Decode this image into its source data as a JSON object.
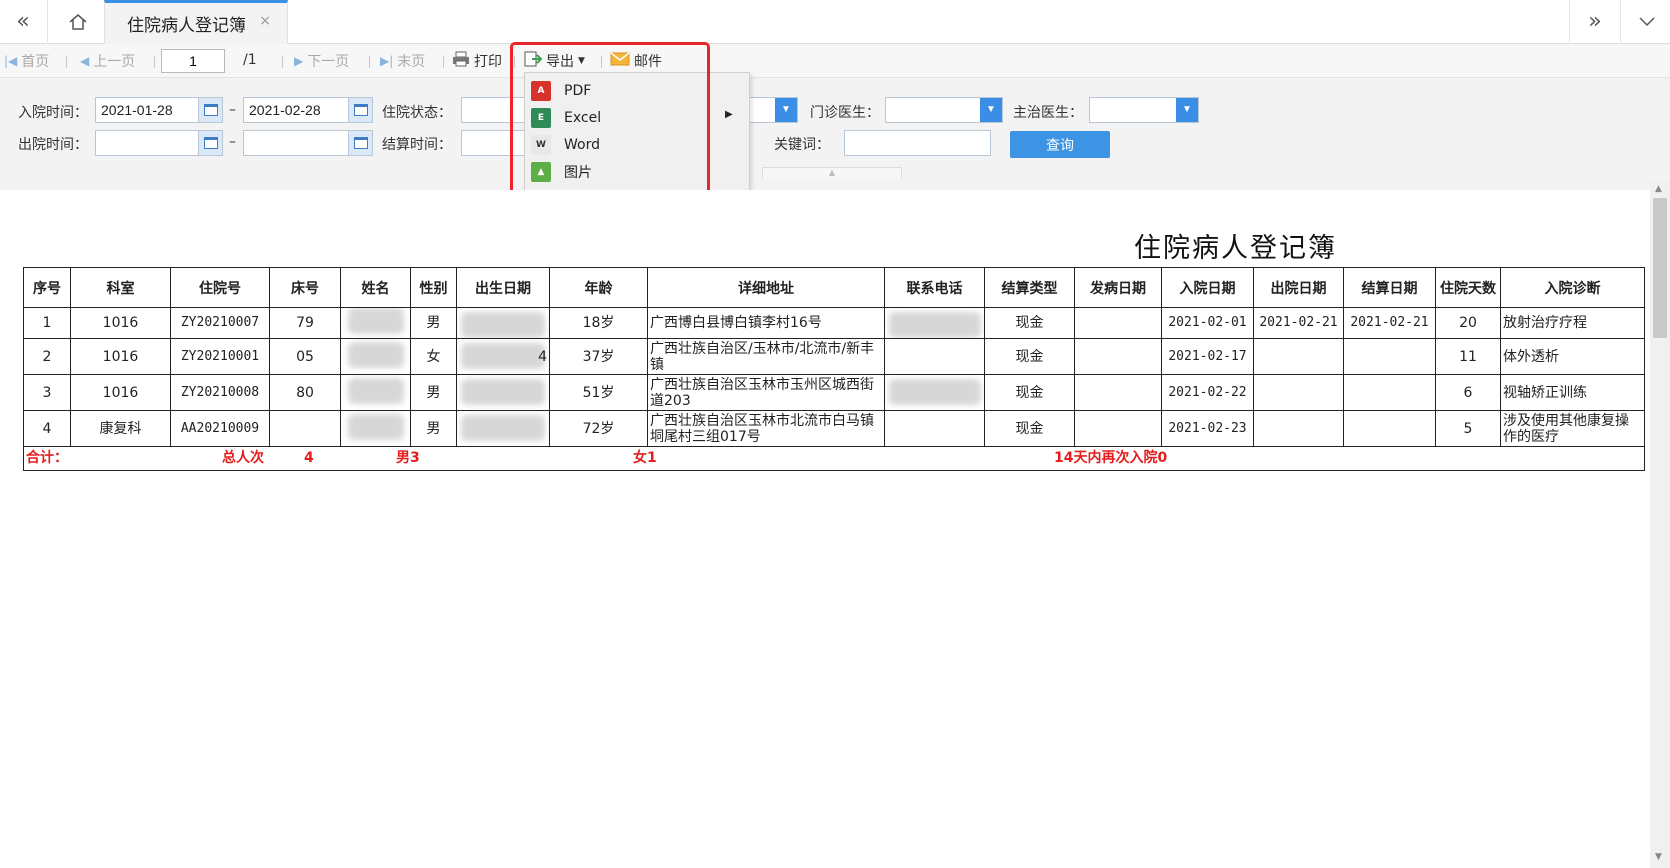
{
  "tabbar": {
    "tab_title": "住院病人登记簿",
    "close_glyph": "×"
  },
  "toolbar": {
    "first": "首页",
    "prev": "上一页",
    "page_value": "1",
    "page_total": "/1",
    "next": "下一页",
    "last": "末页",
    "print": "打印",
    "export": "导出",
    "mail": "邮件"
  },
  "export_menu": {
    "items": [
      "PDF",
      "Excel",
      "Word",
      "图片"
    ]
  },
  "filters": {
    "admit_label": "入院时间：",
    "admit_from": "2021-01-28",
    "admit_to": "2021-02-28",
    "discharge_label": "出院时间：",
    "discharge_from": "",
    "discharge_to": "",
    "dash": "–",
    "status_label": "住院状态：",
    "settle_label": "结算时间：",
    "outpatient_doctor_label": "门诊医生：",
    "attending_doctor_label": "主治医生：",
    "keyword_label": "关键词：",
    "query_button": "查询"
  },
  "report": {
    "title": "住院病人登记簿",
    "columns": [
      "序号",
      "科室",
      "住院号",
      "床号",
      "姓名",
      "性别",
      "出生日期",
      "年龄",
      "详细地址",
      "联系电话",
      "结算类型",
      "发病日期",
      "入院日期",
      "出院日期",
      "结算日期",
      "住院天数",
      "入院诊断"
    ],
    "rows": [
      {
        "no": "1",
        "dept": "1016",
        "id": "ZY20210007",
        "bed": "79",
        "sex": "男",
        "birth": "",
        "age": "18岁",
        "addr": "广西博白县博白镇李村16号",
        "phone": "",
        "settle": "现金",
        "onset": "",
        "admit": "2021-02-01",
        "discharge": "2021-02-21",
        "settle_date": "2021-02-21",
        "days": "20",
        "diag": "放射治疗疗程"
      },
      {
        "no": "2",
        "dept": "1016",
        "id": "ZY20210001",
        "bed": "05",
        "sex": "女",
        "birth": "4",
        "age": "37岁",
        "addr": "广西壮族自治区/玉林市/北流市/新丰镇",
        "phone": "",
        "settle": "现金",
        "onset": "",
        "admit": "2021-02-17",
        "discharge": "",
        "settle_date": "",
        "days": "11",
        "diag": "体外透析"
      },
      {
        "no": "3",
        "dept": "1016",
        "id": "ZY20210008",
        "bed": "80",
        "sex": "男",
        "birth": "",
        "age": "51岁",
        "addr": "广西壮族自治区玉林市玉州区城西街道203",
        "phone": "",
        "settle": "现金",
        "onset": "",
        "admit": "2021-02-22",
        "discharge": "",
        "settle_date": "",
        "days": "6",
        "diag": "视轴矫正训练"
      },
      {
        "no": "4",
        "dept": "康复科",
        "id": "AA20210009",
        "bed": "",
        "sex": "男",
        "birth": "",
        "age": "72岁",
        "addr": "广西壮族自治区玉林市北流市白马镇垌尾村三组017号",
        "phone": "",
        "settle": "现金",
        "onset": "",
        "admit": "2021-02-23",
        "discharge": "",
        "settle_date": "",
        "days": "5",
        "diag": "涉及使用其他康复操作的医疗"
      }
    ],
    "summary": {
      "label": "合计：",
      "total_label": "总人次",
      "total_value": "4",
      "male": "男3",
      "female": "女1",
      "readmit": "14天内再次入院0"
    }
  },
  "colors": {
    "accent": "#3a8ee6",
    "highlight_box": "#e8262b",
    "summary_text": "#e51c1c"
  },
  "icons": [
    "double-chevron-left-icon",
    "home-icon",
    "double-chevron-right-icon",
    "chevron-down-icon",
    "calendar-icon",
    "pdf-icon",
    "excel-icon",
    "word-icon",
    "image-icon",
    "printer-icon",
    "export-icon",
    "mail-icon"
  ]
}
